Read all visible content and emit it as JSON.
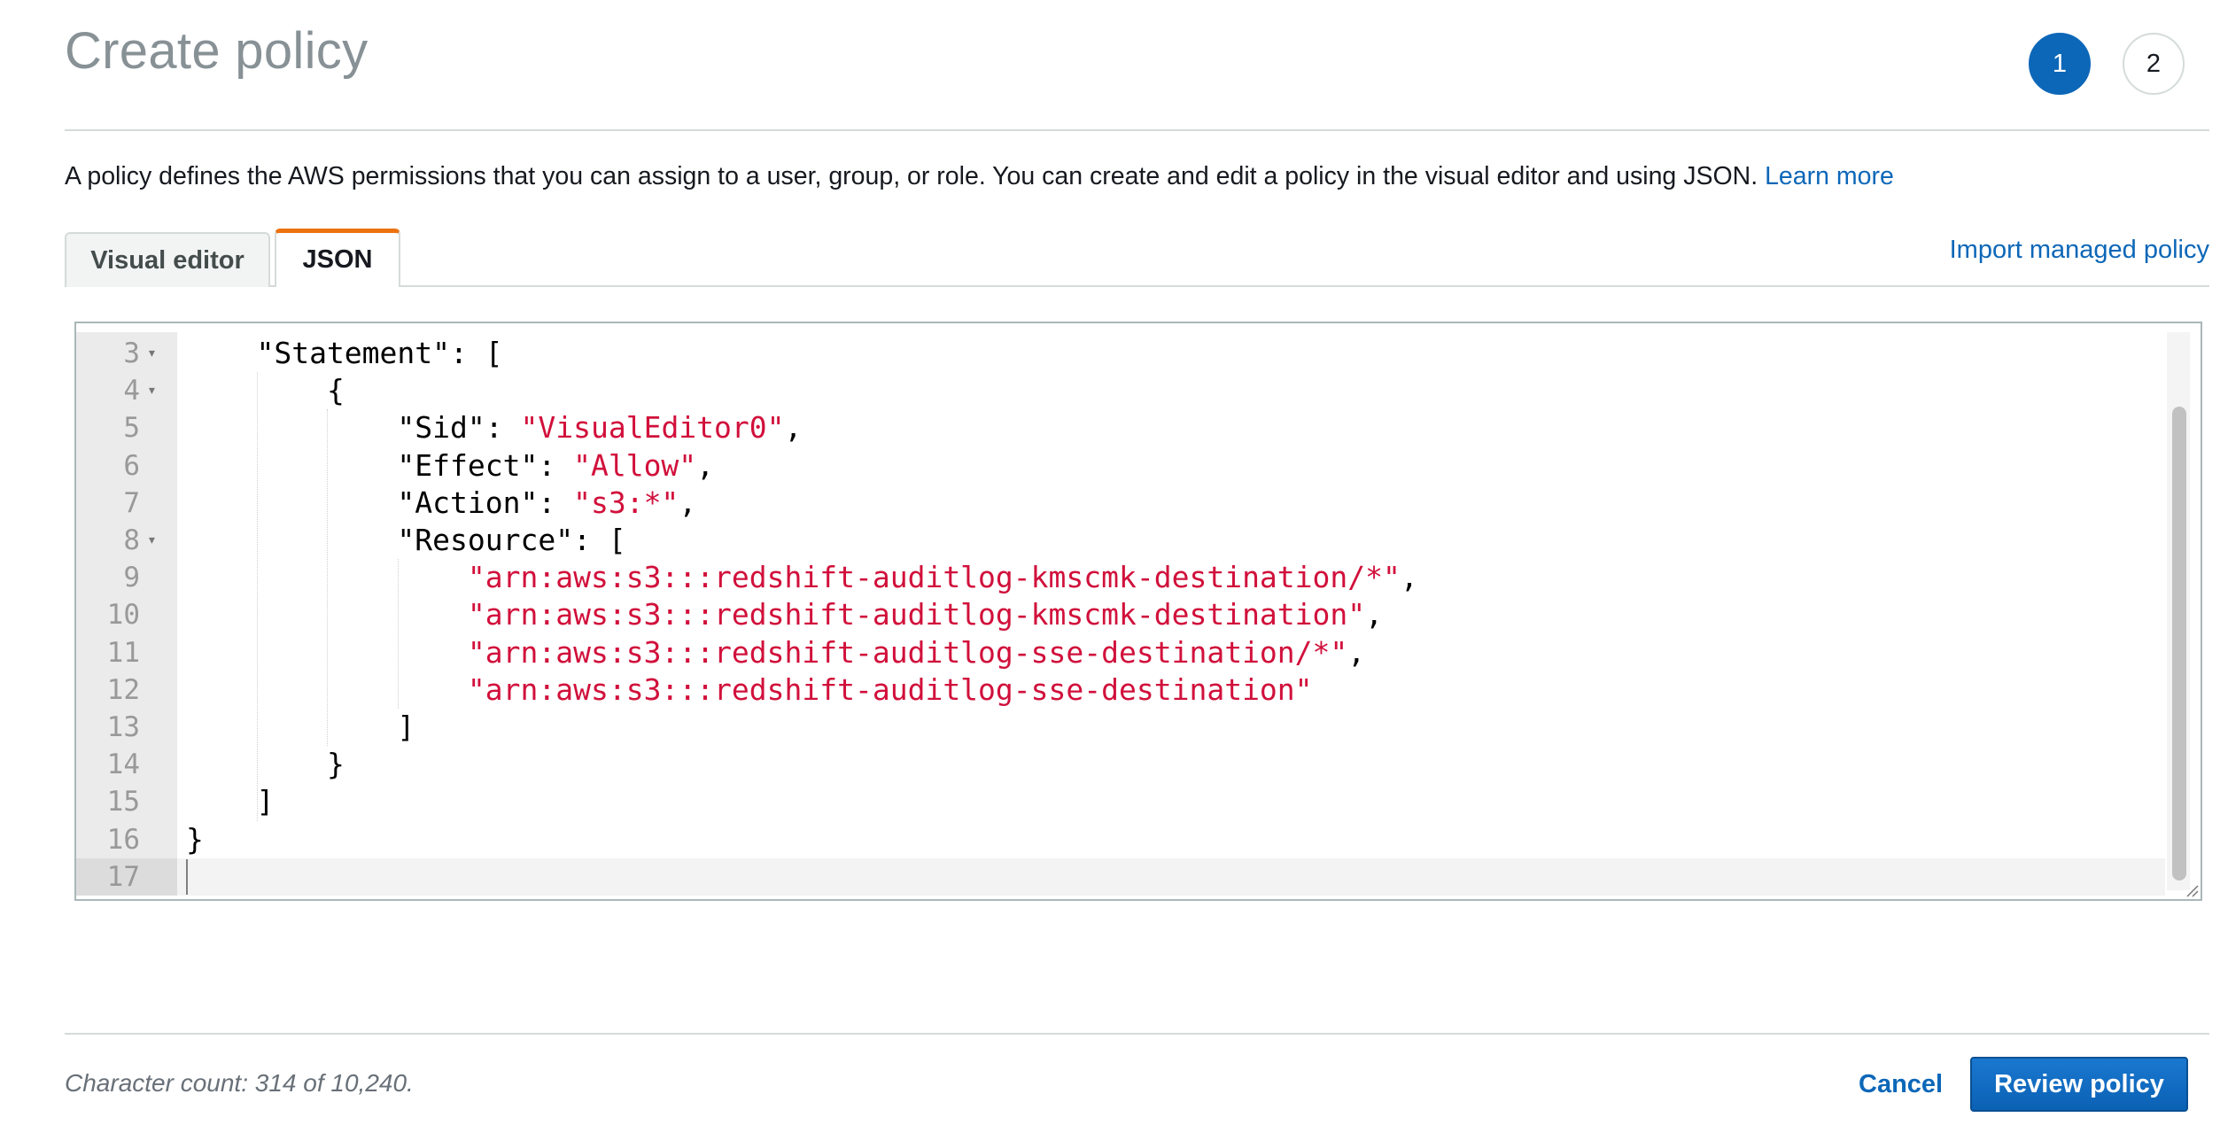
{
  "header": {
    "title": "Create policy",
    "steps": [
      "1",
      "2"
    ],
    "active_step": "1"
  },
  "description": {
    "text": "A policy defines the AWS permissions that you can assign to a user, group, or role. You can create and edit a policy in the visual editor and using JSON.",
    "learn_more": "Learn more"
  },
  "tabs": {
    "visual_editor": "Visual editor",
    "json": "JSON",
    "selected": "JSON",
    "import_managed_policy": "Import managed policy"
  },
  "editor": {
    "lines": [
      {
        "num": "3",
        "fold": true,
        "parts": [
          {
            "t": "    \"Statement\": [",
            "s": false
          }
        ]
      },
      {
        "num": "4",
        "fold": true,
        "parts": [
          {
            "t": "        {",
            "s": false
          }
        ]
      },
      {
        "num": "5",
        "fold": false,
        "parts": [
          {
            "t": "            \"Sid\": ",
            "s": false
          },
          {
            "t": "\"VisualEditor0\"",
            "s": true
          },
          {
            "t": ",",
            "s": false
          }
        ]
      },
      {
        "num": "6",
        "fold": false,
        "parts": [
          {
            "t": "            \"Effect\": ",
            "s": false
          },
          {
            "t": "\"Allow\"",
            "s": true
          },
          {
            "t": ",",
            "s": false
          }
        ]
      },
      {
        "num": "7",
        "fold": false,
        "parts": [
          {
            "t": "            \"Action\": ",
            "s": false
          },
          {
            "t": "\"s3:*\"",
            "s": true
          },
          {
            "t": ",",
            "s": false
          }
        ]
      },
      {
        "num": "8",
        "fold": true,
        "parts": [
          {
            "t": "            \"Resource\": [",
            "s": false
          }
        ]
      },
      {
        "num": "9",
        "fold": false,
        "parts": [
          {
            "t": "                ",
            "s": false
          },
          {
            "t": "\"arn:aws:s3:::redshift-auditlog-kmscmk-destination/*\"",
            "s": true
          },
          {
            "t": ",",
            "s": false
          }
        ]
      },
      {
        "num": "10",
        "fold": false,
        "parts": [
          {
            "t": "                ",
            "s": false
          },
          {
            "t": "\"arn:aws:s3:::redshift-auditlog-kmscmk-destination\"",
            "s": true
          },
          {
            "t": ",",
            "s": false
          }
        ]
      },
      {
        "num": "11",
        "fold": false,
        "parts": [
          {
            "t": "                ",
            "s": false
          },
          {
            "t": "\"arn:aws:s3:::redshift-auditlog-sse-destination/*\"",
            "s": true
          },
          {
            "t": ",",
            "s": false
          }
        ]
      },
      {
        "num": "12",
        "fold": false,
        "parts": [
          {
            "t": "                ",
            "s": false
          },
          {
            "t": "\"arn:aws:s3:::redshift-auditlog-sse-destination\"",
            "s": true
          }
        ]
      },
      {
        "num": "13",
        "fold": false,
        "parts": [
          {
            "t": "            ]",
            "s": false
          }
        ]
      },
      {
        "num": "14",
        "fold": false,
        "parts": [
          {
            "t": "        }",
            "s": false
          }
        ]
      },
      {
        "num": "15",
        "fold": false,
        "parts": [
          {
            "t": "    ]",
            "s": false
          }
        ]
      },
      {
        "num": "16",
        "fold": false,
        "parts": [
          {
            "t": "}",
            "s": false
          }
        ]
      },
      {
        "num": "17",
        "fold": false,
        "parts": [
          {
            "t": "",
            "s": false
          }
        ]
      }
    ],
    "active_line": "17",
    "string_color": "#d1103b"
  },
  "footer": {
    "character_count": "Character count: 314 of 10,240.",
    "cancel": "Cancel",
    "review_policy": "Review policy"
  },
  "colors": {
    "primary_button": "#0d67b8",
    "link": "#0d67b8",
    "active_tab_accent": "#ec7211"
  }
}
